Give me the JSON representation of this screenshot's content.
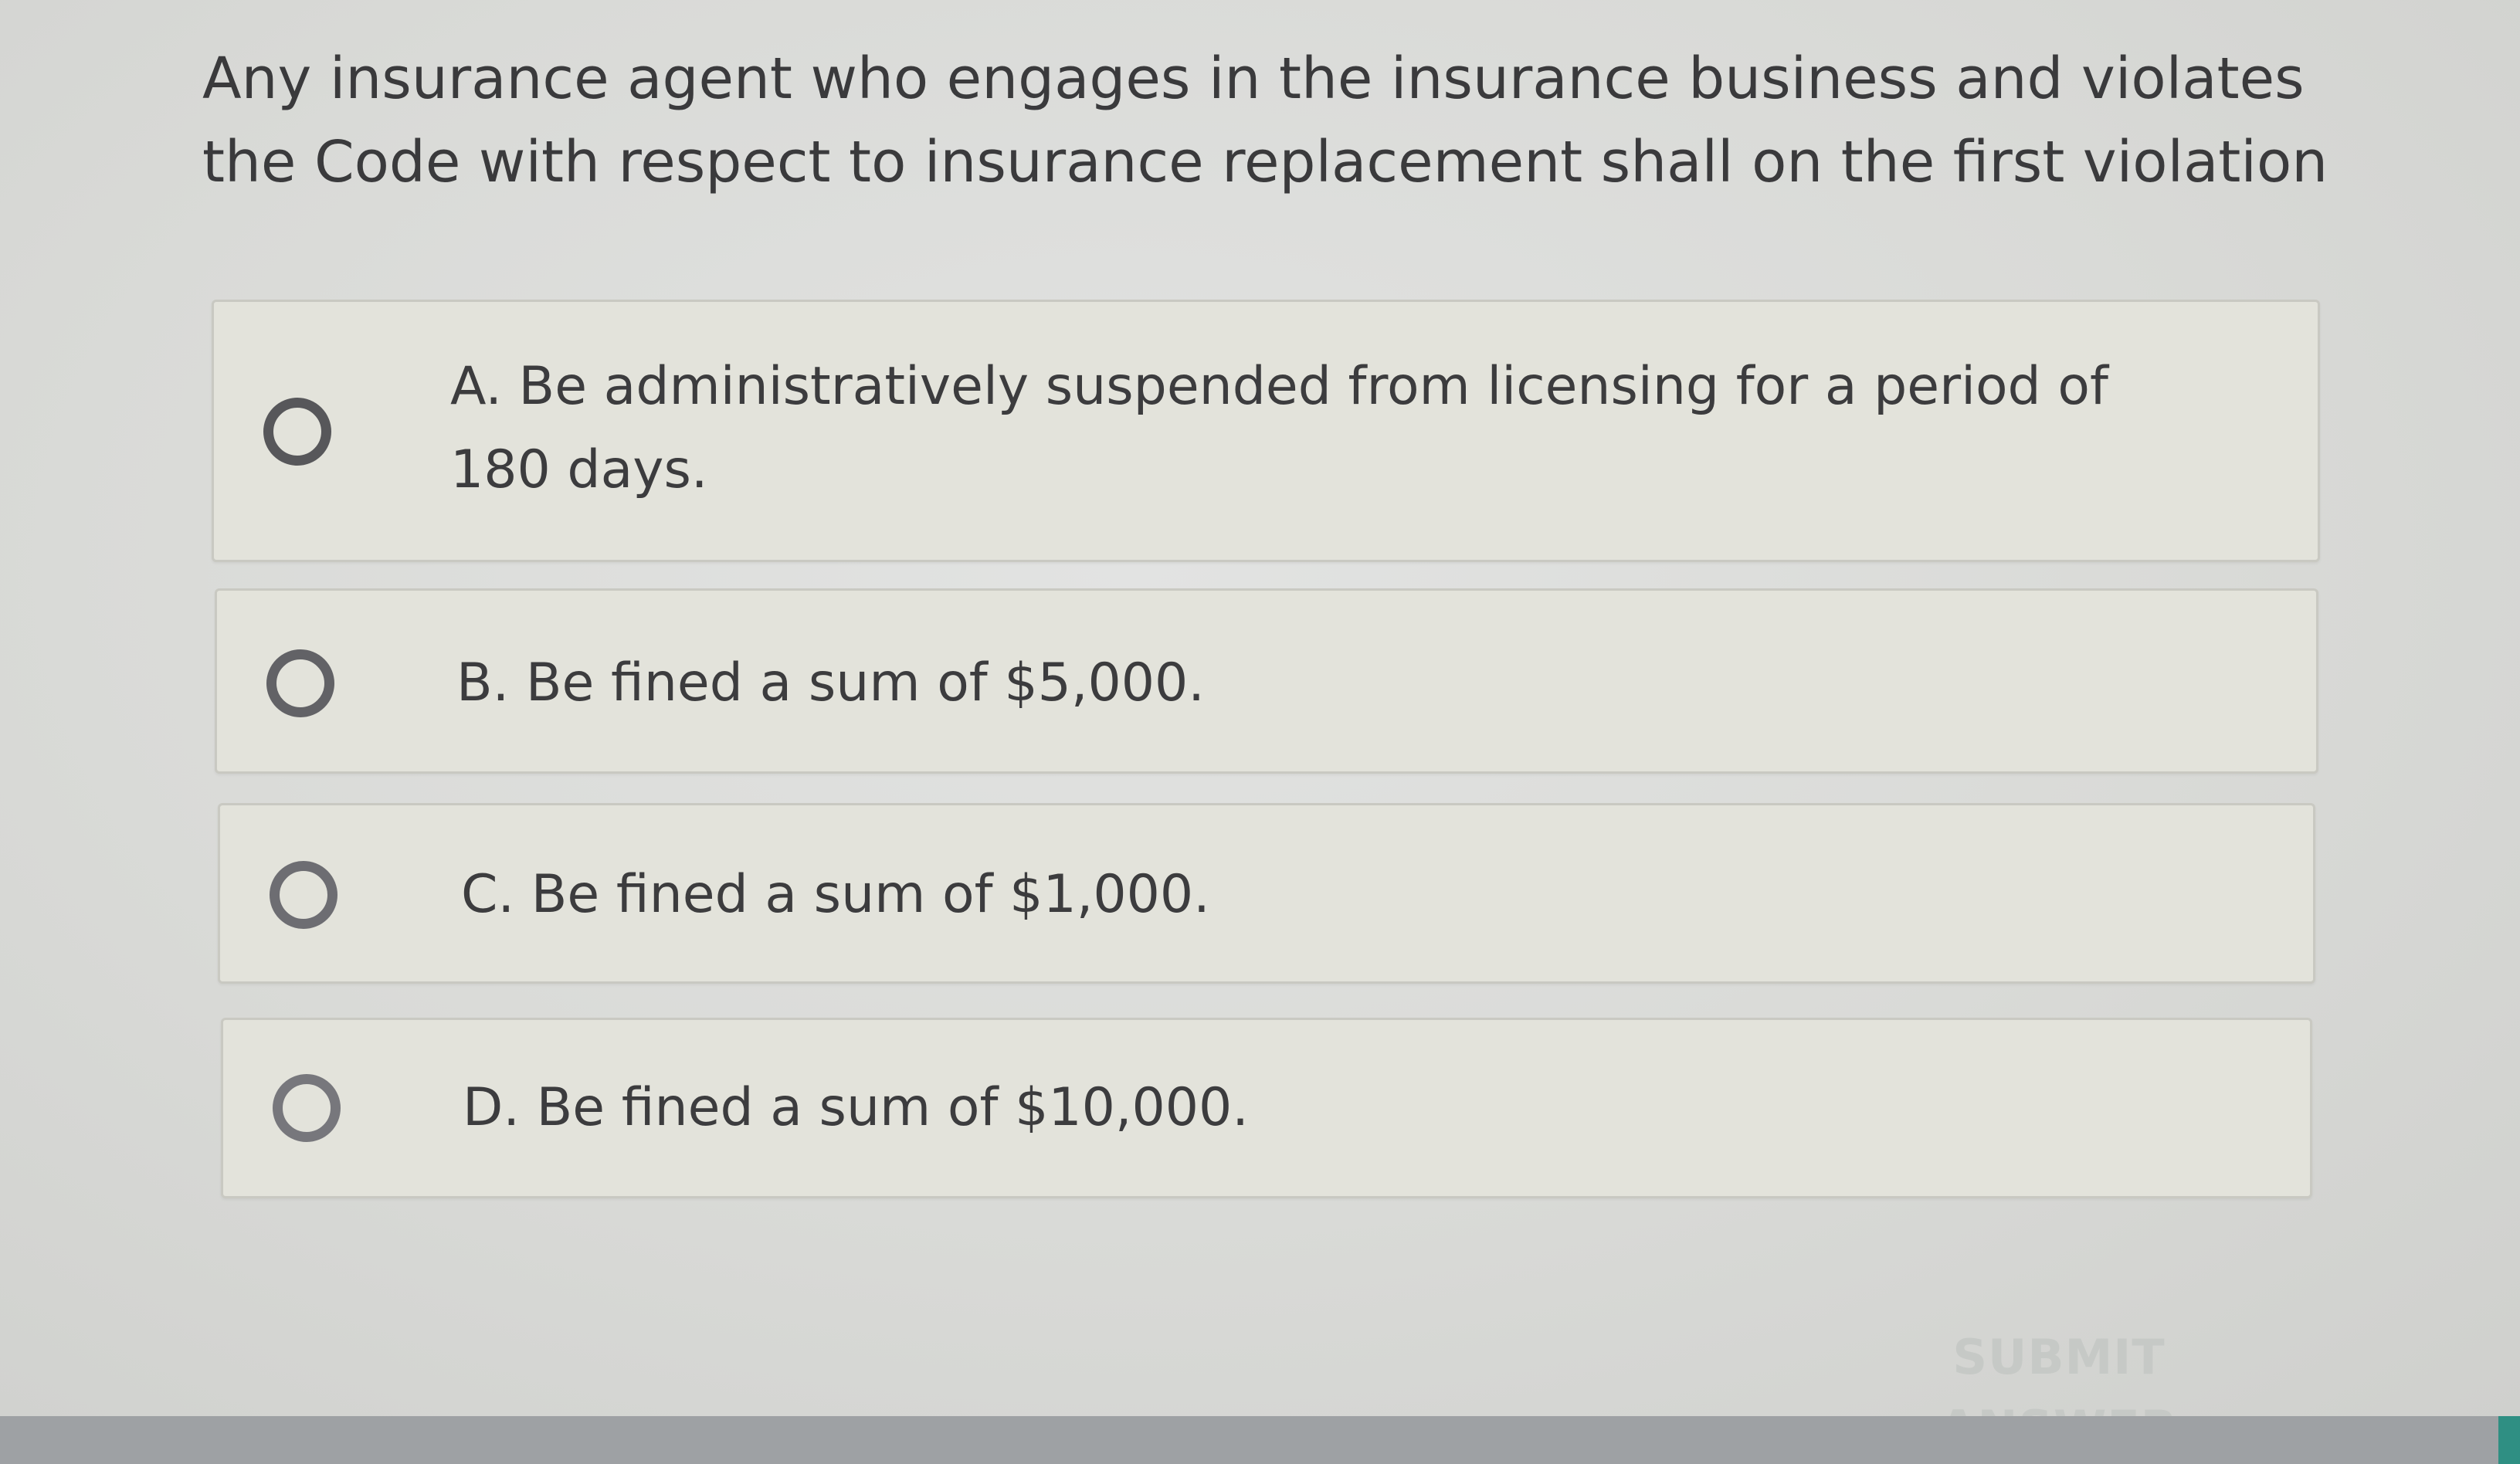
{
  "question": {
    "text": "Any insurance agent who engages in the insurance business and violates the Code with respect to insurance replacement shall on the first violation"
  },
  "options": [
    {
      "letter": "A",
      "label": "A. Be administratively suspended from licensing for a period of 180 days.",
      "selected": false
    },
    {
      "letter": "B",
      "label": "B. Be fined a sum of $5,000.",
      "selected": false
    },
    {
      "letter": "C",
      "label": "C. Be fined a sum of $1,000.",
      "selected": false
    },
    {
      "letter": "D",
      "label": "D. Be fined a sum of $10,000.",
      "selected": false
    }
  ],
  "submit": {
    "label": "SUBMIT ANSWER",
    "disabled": true
  },
  "icons": {
    "radio": "radio-unchecked-icon"
  },
  "colors": {
    "text": "#3a3a3c",
    "option_background": "#e3e3db",
    "submit_disabled": "#c6c9c6",
    "accent": "#2f8f83"
  }
}
